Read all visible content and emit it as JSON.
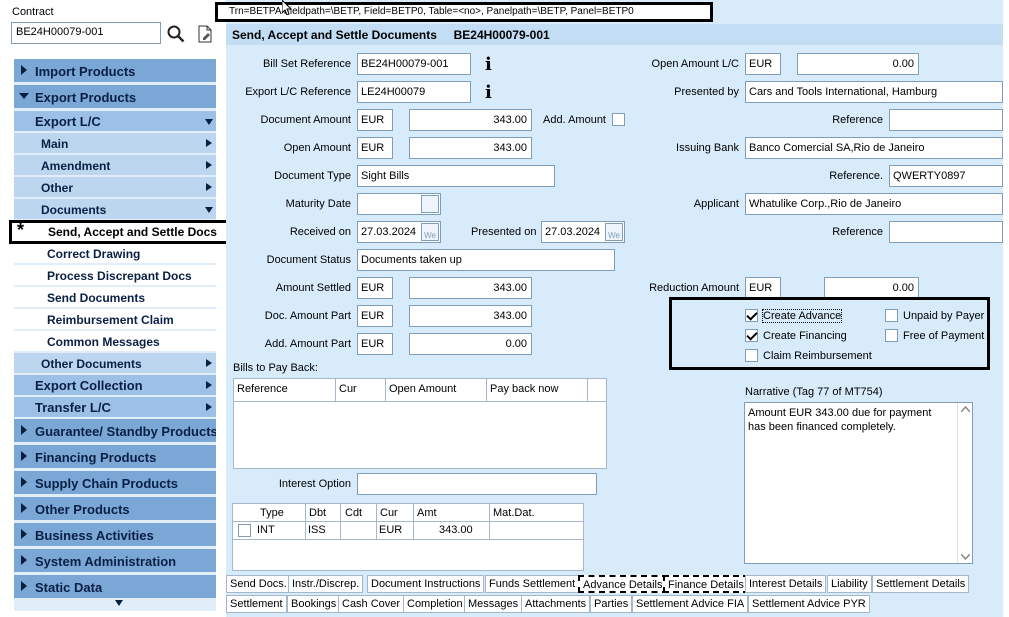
{
  "contract": {
    "label": "Contract",
    "value": "BE24H00079-001"
  },
  "debug_bar": "Trn=BETPA  Fieldpath=\\BETP, Field=BETP0, Table=<no>, Panelpath=\\BETP, Panel=BETP0",
  "title": "Send, Accept and Settle Documents     BE24H00079-001",
  "nav": {
    "items": [
      {
        "label": "Import Products"
      },
      {
        "label": "Export Products"
      },
      {
        "label": "Export L/C"
      },
      {
        "label": "Main"
      },
      {
        "label": "Amendment"
      },
      {
        "label": "Other"
      },
      {
        "label": "Documents"
      },
      {
        "label": "Send, Accept and Settle Docs"
      },
      {
        "label": "Correct Drawing"
      },
      {
        "label": "Process Discrepant Docs"
      },
      {
        "label": "Send Documents"
      },
      {
        "label": "Reimbursement Claim"
      },
      {
        "label": "Common Messages"
      },
      {
        "label": "Other Documents"
      },
      {
        "label": "Export Collection"
      },
      {
        "label": "Transfer L/C"
      },
      {
        "label": "Guarantee/ Standby Products"
      },
      {
        "label": "Financing Products"
      },
      {
        "label": "Supply Chain Products"
      },
      {
        "label": "Other Products"
      },
      {
        "label": "Business Activities"
      },
      {
        "label": "System Administration"
      },
      {
        "label": "Static Data"
      }
    ],
    "selected_marker": "*"
  },
  "form": {
    "bill_set_reference": {
      "label": "Bill Set Reference",
      "value": "BE24H00079-001"
    },
    "export_lc_reference": {
      "label": "Export L/C Reference",
      "value": "LE24H00079"
    },
    "document_amount": {
      "label": "Document Amount",
      "cur": "EUR",
      "value": "343.00"
    },
    "add_amount": {
      "label": "Add. Amount"
    },
    "open_amount": {
      "label": "Open Amount",
      "cur": "EUR",
      "value": "343.00"
    },
    "document_type": {
      "label": "Document Type",
      "value": "Sight Bills"
    },
    "maturity_date": {
      "label": "Maturity Date",
      "value": ""
    },
    "received_on": {
      "label": "Received on",
      "value": "27.03.2024"
    },
    "presented_on": {
      "label": "Presented on",
      "value": "27.03.2024"
    },
    "document_status": {
      "label": "Document Status",
      "value": "Documents taken up"
    },
    "amount_settled": {
      "label": "Amount Settled",
      "cur": "EUR",
      "value": "343.00"
    },
    "doc_amount_part": {
      "label": "Doc. Amount Part",
      "cur": "EUR",
      "value": "343.00"
    },
    "add_amount_part": {
      "label": "Add. Amount Part",
      "cur": "EUR",
      "value": "0.00"
    },
    "bills_to_pay_back": {
      "label": "Bills to Pay Back:",
      "columns": [
        "Reference",
        "Cur",
        "Open Amount",
        "Pay back now"
      ]
    },
    "interest_option": {
      "label": "Interest Option",
      "value": ""
    },
    "interest_table": {
      "columns": [
        "Type",
        "Dbt",
        "Cdt",
        "Cur",
        "Amt",
        "Mat.Dat."
      ],
      "rows": [
        {
          "type": "INT",
          "dbt": "ISS",
          "cdt": "",
          "cur": "EUR",
          "amt": "343.00",
          "mat": ""
        }
      ]
    },
    "open_amount_lc": {
      "label": "Open Amount L/C",
      "cur": "EUR",
      "value": "0.00"
    },
    "presented_by": {
      "label": "Presented by",
      "value": "Cars and Tools International, Hamburg"
    },
    "reference1": {
      "label": "Reference",
      "value": ""
    },
    "issuing_bank": {
      "label": "Issuing Bank",
      "value": "Banco Comercial SA,Rio de Janeiro"
    },
    "reference2": {
      "label": "Reference.",
      "value": "QWERTY0897"
    },
    "applicant": {
      "label": "Applicant",
      "value": "Whatulike Corp.,Rio de Janeiro"
    },
    "reference3": {
      "label": "Reference",
      "value": ""
    },
    "reduction_amount": {
      "label": "Reduction Amount",
      "cur": "EUR",
      "value": "0.00"
    },
    "checkboxes": {
      "create_advance": {
        "label": "Create Advance",
        "checked": true
      },
      "create_financing": {
        "label": "Create Financing",
        "checked": true
      },
      "claim_reimbursement": {
        "label": "Claim Reimbursement",
        "checked": false
      },
      "unpaid_by_payer": {
        "label": "Unpaid by Payer",
        "checked": false
      },
      "free_of_payment": {
        "label": "Free of Payment",
        "checked": false
      }
    },
    "narrative": {
      "label": "Narrative (Tag 77 of MT754)",
      "line1": "Amount EUR 343.00  due for payment",
      "line2": "has been financed completely."
    }
  },
  "tabs_row1": [
    "Send Docs.",
    "Instr./Discrep.",
    "Document Instructions",
    "Funds Settlement",
    "Advance Details",
    "Finance Details",
    "Interest Details",
    "Liability",
    "Settlement Details"
  ],
  "tabs_row2": [
    "Settlement",
    "Bookings",
    "Cash Cover",
    "Completion",
    "Messages",
    "Attachments",
    "Parties",
    "Settlement Advice FIA",
    "Settlement Advice PYR"
  ],
  "calendar_icon_text": "We",
  "colors": {
    "nav_l1": "#7aa7d6",
    "nav_l2": "#9dc0e6",
    "panel_bg": "#d7ebfa"
  }
}
